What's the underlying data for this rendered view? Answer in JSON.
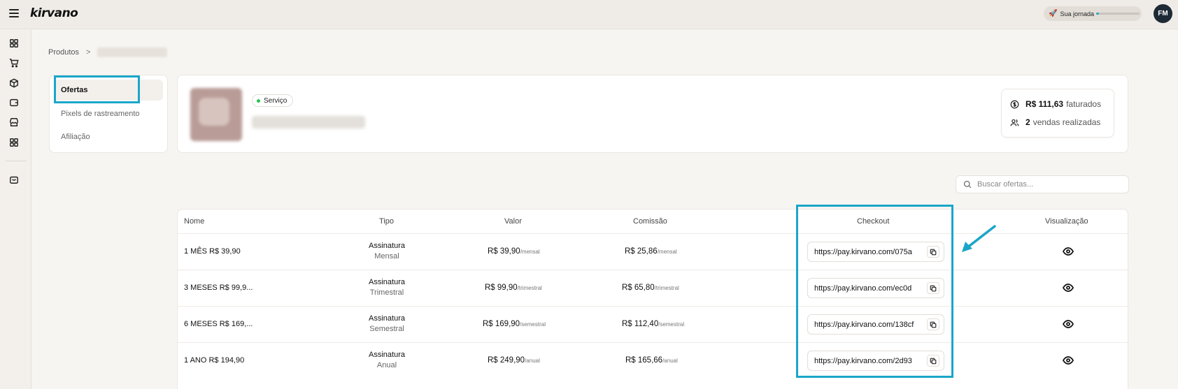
{
  "header": {
    "logo": "kirvano",
    "journey_label": "Sua jornada",
    "journey_progress_percent": 5,
    "avatar_initials": "FM"
  },
  "rail": {
    "icons": [
      "dashboard-icon",
      "cart-icon",
      "box-icon",
      "wallet-icon",
      "store-icon",
      "apps-icon",
      "shopping-bag-icon"
    ],
    "active": "box-icon"
  },
  "breadcrumb": {
    "root": "Produtos",
    "separator": ">"
  },
  "side_menu": {
    "items": [
      {
        "label": "Ofertas",
        "active": true
      },
      {
        "label": "Pixels de rastreamento",
        "active": false
      },
      {
        "label": "Afiliação",
        "active": false
      }
    ]
  },
  "product": {
    "badge": "Serviço",
    "badge_color": "#2cc04f",
    "stats": {
      "revenue_value": "R$ 111,63",
      "revenue_label": "faturados",
      "sales_value": "2",
      "sales_label": "vendas realizadas"
    }
  },
  "search": {
    "placeholder": "Buscar ofertas..."
  },
  "table": {
    "headers": {
      "nome": "Nome",
      "tipo": "Tipo",
      "valor": "Valor",
      "comissao": "Comissão",
      "checkout": "Checkout",
      "visualizacao": "Visualização"
    },
    "rows": [
      {
        "nome": "1 MÊS R$ 39,90",
        "tipo": "Assinatura",
        "periodo": "Mensal",
        "valor": "R$ 39,90",
        "valor_suffix": "/mensal",
        "comissao": "R$ 25,86",
        "comissao_suffix": "/mensal",
        "checkout": "https://pay.kirvano.com/075a"
      },
      {
        "nome": "3 MESES R$ 99,9...",
        "tipo": "Assinatura",
        "periodo": "Trimestral",
        "valor": "R$ 99,90",
        "valor_suffix": "/trimestral",
        "comissao": "R$ 65,80",
        "comissao_suffix": "/trimestral",
        "checkout": "https://pay.kirvano.com/ec0d"
      },
      {
        "nome": "6 MESES R$ 169,...",
        "tipo": "Assinatura",
        "periodo": "Semestral",
        "valor": "R$ 169,90",
        "valor_suffix": "/semestral",
        "comissao": "R$ 112,40",
        "comissao_suffix": "/semestral",
        "checkout": "https://pay.kirvano.com/138cf"
      },
      {
        "nome": "1 ANO R$ 194,90",
        "tipo": "Assinatura",
        "periodo": "Anual",
        "valor": "R$ 249,90",
        "valor_suffix": "/anual",
        "comissao": "R$ 165,66",
        "comissao_suffix": "/anual",
        "checkout": "https://pay.kirvano.com/2d93"
      }
    ]
  },
  "annotation_color": "#1aa6c9"
}
